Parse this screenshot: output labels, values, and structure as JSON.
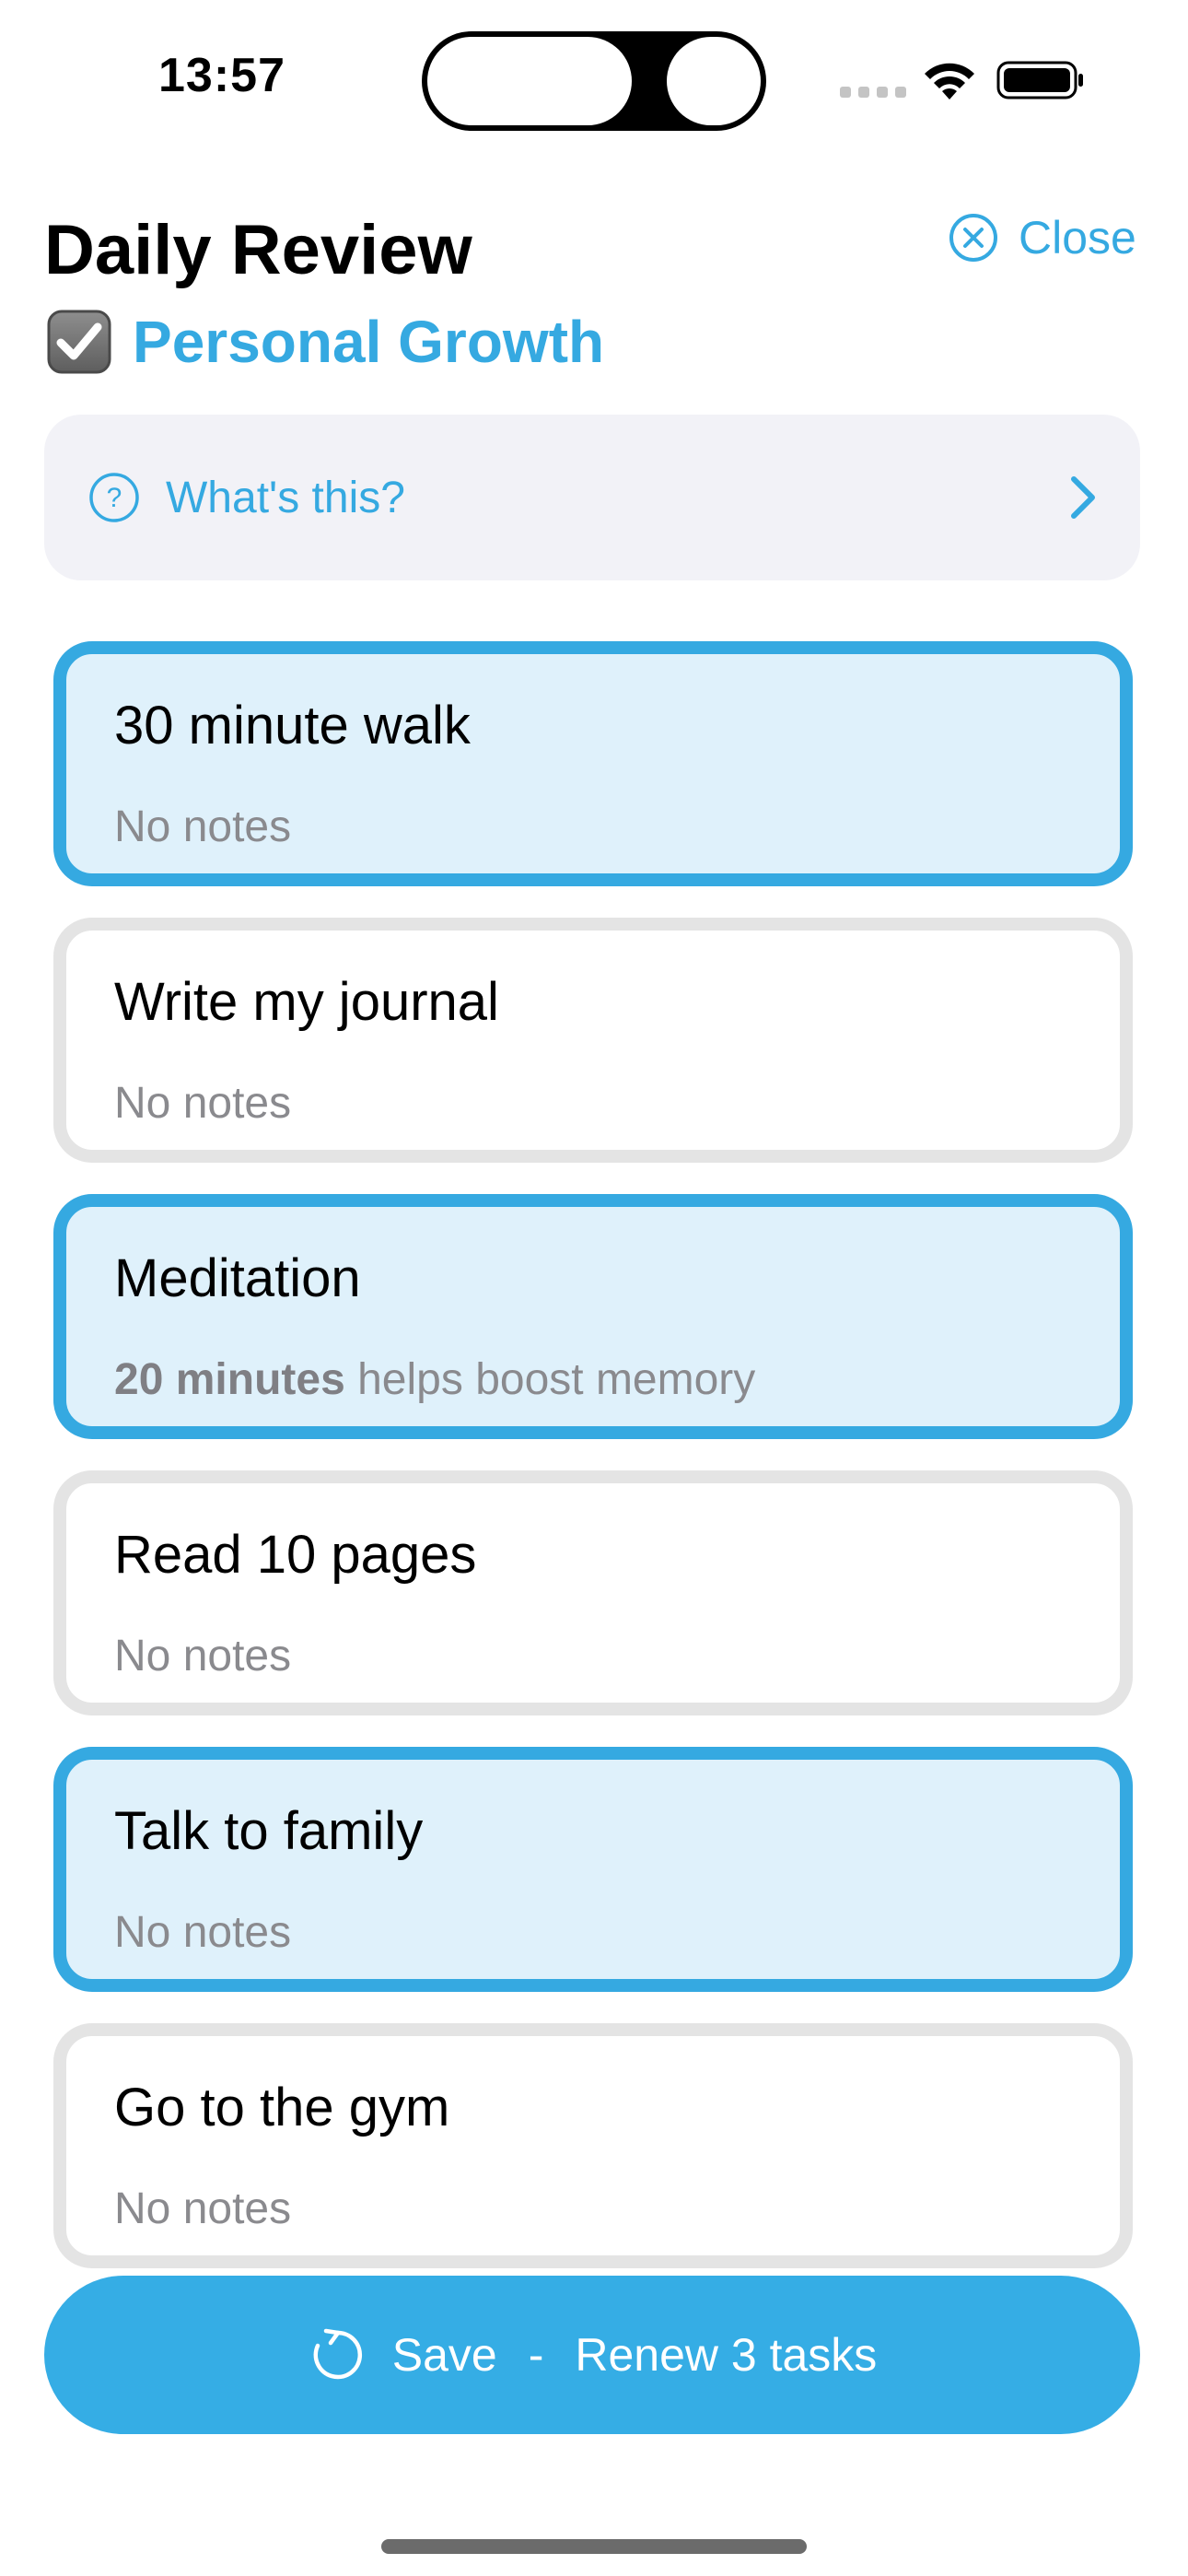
{
  "status_bar": {
    "time": "13:57"
  },
  "header": {
    "title": "Daily Review",
    "close_label": "Close",
    "category_label": "Personal Growth"
  },
  "info_panel": {
    "label": "What's this?"
  },
  "tasks": [
    {
      "title": "30 minute walk",
      "note": "No notes",
      "selected": true
    },
    {
      "title": "Write my journal",
      "note": "No notes",
      "selected": false
    },
    {
      "title": "Meditation",
      "note_bold": "20 minutes",
      "note_rest": " helps boost memory",
      "selected": true
    },
    {
      "title": "Read 10 pages",
      "note": "No notes",
      "selected": false
    },
    {
      "title": "Talk to family",
      "note": "No notes",
      "selected": true
    },
    {
      "title": "Go to the gym",
      "note": "No notes",
      "selected": false
    }
  ],
  "save_button": {
    "save_label": "Save",
    "separator": "-",
    "renew_label": "Renew 3 tasks"
  },
  "colors": {
    "accent": "#35a9e1",
    "selected_background": "#dff1fb",
    "unselected_border": "#e4e4e4",
    "info_background": "#f2f2f7"
  },
  "icons": {
    "close": "close-circle-icon",
    "category": "checkbox-icon",
    "info": "help-icon",
    "info_chevron": "chevron-right-icon",
    "save": "refresh-icon"
  }
}
